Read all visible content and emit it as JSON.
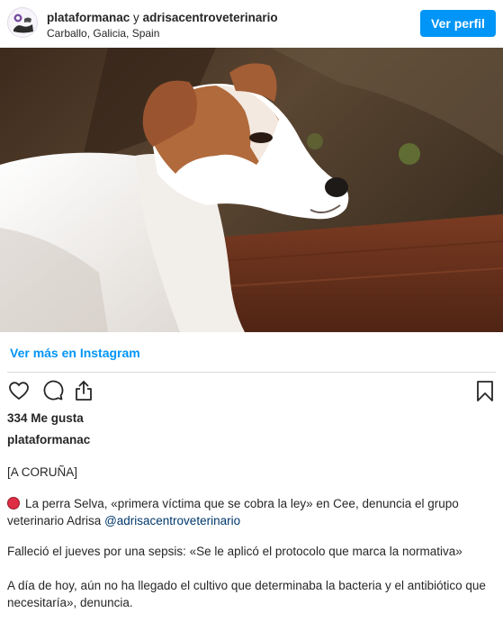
{
  "header": {
    "username": "plataformanac",
    "connector": "y",
    "collaborator": "adrisacentroveterinario",
    "location": "Carballo, Galicia, Spain",
    "view_profile_label": "Ver perfil"
  },
  "post": {
    "image_subject": "jack-russell-terrier-photo",
    "view_more_label": "Ver más en Instagram",
    "likes": "334 Me gusta",
    "author": "plataformanac"
  },
  "caption": {
    "line1": "[A CORUÑA]",
    "para2_text": "La perra Selva, «primera víctima que se cobra la ley» en Cee, denuncia el grupo veterinario Adrisa ",
    "para2_mention": "@adrisacentroveterinario",
    "para3": "Falleció el jueves por una sepsis: «Se le aplicó el protocolo que marca la normativa»",
    "para4": "A día de hoy, aún no ha llegado el cultivo que determinaba la bacteria y el antibiótico que necesitaría», denuncia."
  },
  "icons": {
    "like": "heart-icon",
    "comment": "comment-icon",
    "share": "share-icon",
    "save": "bookmark-icon",
    "status_emoji": "red-circle-icon"
  },
  "colors": {
    "accent": "#0095f6",
    "mention": "#00376b",
    "text": "#262626",
    "divider": "#dbdbdb",
    "emoji_red": "#dd2e44"
  }
}
